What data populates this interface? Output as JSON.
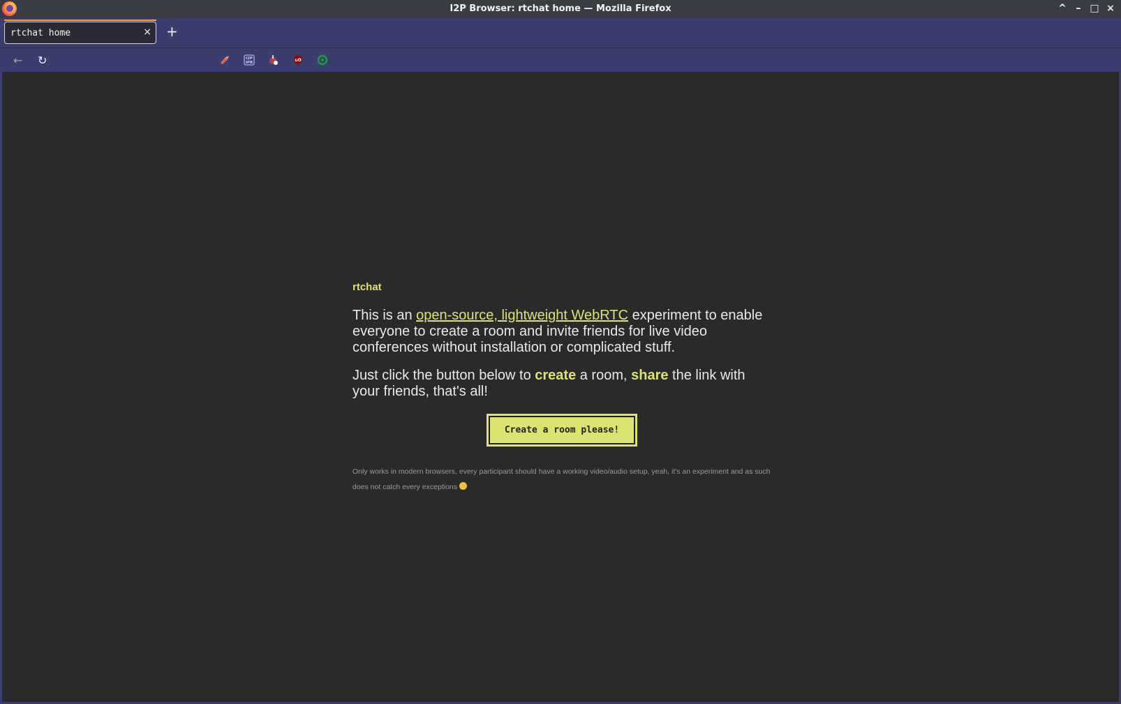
{
  "window": {
    "title": "I2P Browser: rtchat home — Mozilla Firefox",
    "controls": [
      "^",
      "–",
      "□",
      "×"
    ]
  },
  "tabs": [
    {
      "label": "rtchat home",
      "close": "×"
    }
  ],
  "tabstrip": {
    "new_tab": "+"
  },
  "navbar": {
    "back": "←",
    "reload": "↻",
    "extensions": [
      "i2p-bee-icon",
      "i2pb-icon",
      "torrent-icon",
      "ublock-icon",
      "green-extension-icon"
    ],
    "i2pb_text": "I2P\nIPB",
    "ublock_text": "uO"
  },
  "page": {
    "site_name": "rtchat",
    "intro_before": "This is an ",
    "intro_link": "open-source, lightweight WebRTC",
    "intro_after": " experiment to enable everyone to create a room and invite friends for live video conferences without installation or complicated stuff.",
    "p2_a": "Just click the button below to ",
    "p2_b": "create",
    "p2_c": " a room, ",
    "p2_d": "share",
    "p2_e": " the link with your friends, that's all!",
    "cta_label": "Create a room please!",
    "note": "Only works in modern browsers, every participant should have a working video/audio setup, yeah, it's an experiment and as such does not catch every exceptions "
  },
  "colors": {
    "accent": "#dde36f",
    "page_bg": "#2a2a2a",
    "chrome_bg": "#3b3d6f",
    "titlebar_bg": "#3a3c44"
  }
}
